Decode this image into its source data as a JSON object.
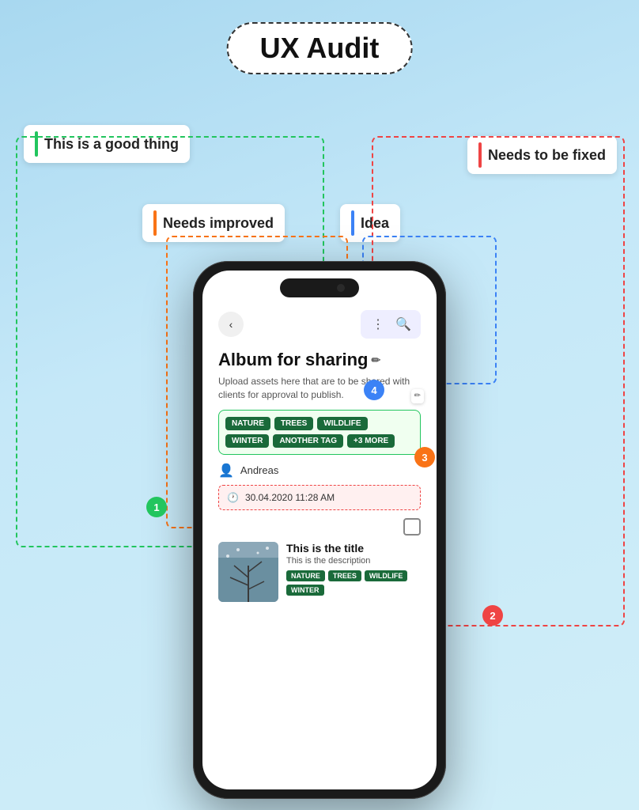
{
  "title": "UX Audit",
  "labels": {
    "good": "This is a good thing",
    "fix": "Needs to be fixed",
    "improve": "Needs improved",
    "idea": "Idea"
  },
  "colors": {
    "green": "#22c55e",
    "red": "#ef4444",
    "orange": "#f97316",
    "blue": "#3b82f6"
  },
  "badges": {
    "b1": "1",
    "b2": "2",
    "b3": "3",
    "b4": "4"
  },
  "phone": {
    "back_icon": "‹",
    "menu_icon": "⋮",
    "search_icon": "🔍",
    "album_title": "Album for sharing",
    "edit_icon": "✏",
    "description": "Upload assets here that are to be shared with clients for approval to publish.",
    "tags": [
      "NATURE",
      "TREES",
      "WILDLIFE",
      "WINTER",
      "ANOTHER TAG",
      "+3 MORE"
    ],
    "author": "Andreas",
    "date": "30.04.2020 11:28 AM",
    "media_title": "This is the title",
    "media_desc": "This is the description",
    "media_tags": [
      "NATURE",
      "TREES",
      "WILDLIFE",
      "WINTER"
    ]
  }
}
